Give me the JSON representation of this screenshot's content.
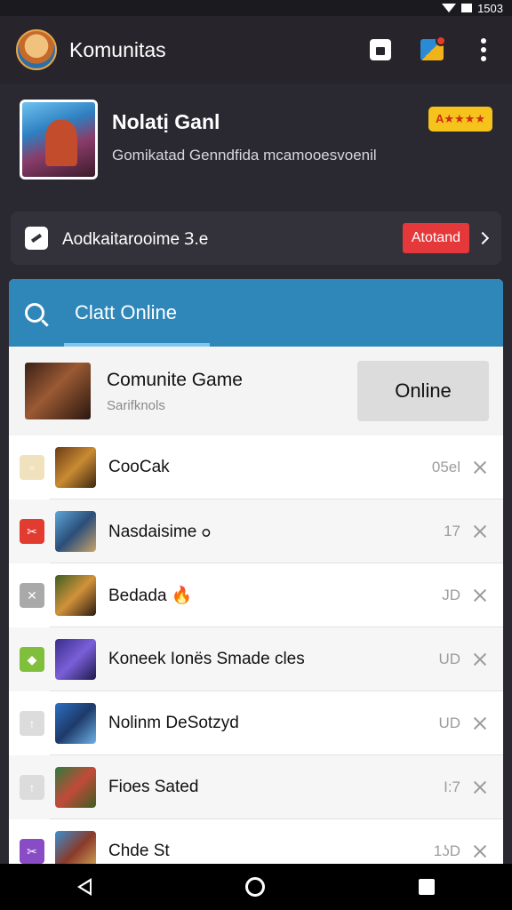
{
  "status_bar": {
    "time": "1503"
  },
  "app_bar": {
    "title": "Komunitas"
  },
  "game_card": {
    "title": "Nolatị Ganl",
    "subtitle": "Gomikatad Genndfida mcamooesvoenil",
    "rating": "A★★★★"
  },
  "promo": {
    "text": "Aodkaitarooime Ɜ.e",
    "button": "Atotand"
  },
  "panel": {
    "tab": "Clatt Online",
    "featured": {
      "title": "Comunite Game",
      "subtitle": "Sarifknols",
      "button": "Online"
    },
    "rows": [
      {
        "title": "CooCak",
        "meta": "05el",
        "tag_color": "#efe2bd",
        "tag_glyph": "▫",
        "thumb": "linear-gradient(135deg,#6a3b16,#c98b32,#3b2610)"
      },
      {
        "title": "Nasdaisime ߋ",
        "meta": "17",
        "tag_color": "#e23b2f",
        "tag_glyph": "✂",
        "thumb": "linear-gradient(135deg,#5ea7d8,#2b4e7a,#c9a36a)"
      },
      {
        "title": "Bedada 🔥",
        "meta": "JD",
        "tag_color": "#a9a9a9",
        "tag_glyph": "✕",
        "thumb": "linear-gradient(135deg,#3c5e22,#d1923a,#2b1b12)"
      },
      {
        "title": "Koneek  Ionës Smade cles",
        "meta": "UD",
        "tag_color": "#7fbf3c",
        "tag_glyph": "◆",
        "thumb": "linear-gradient(135deg,#3a2d8c,#7a5fd8,#1d1a4a)"
      },
      {
        "title": "Nolinm DeSotzyd",
        "meta": "UD",
        "tag_color": "#dcdcdc",
        "tag_glyph": "↑",
        "thumb": "linear-gradient(135deg,#2e6fc4,#1d3a6a,#6eb2e6)"
      },
      {
        "title": "Fioes Sated",
        "meta": "I:7",
        "tag_color": "#dcdcdc",
        "tag_glyph": "↑",
        "thumb": "linear-gradient(135deg,#2f7a3b,#c24a3a,#3c5e22)"
      },
      {
        "title": "Chde St",
        "meta": "1ʖD",
        "tag_color": "#8a4cc4",
        "tag_glyph": "✂",
        "thumb": "linear-gradient(135deg,#3b8fd0,#8a3a2a,#d8b05a)"
      }
    ]
  }
}
